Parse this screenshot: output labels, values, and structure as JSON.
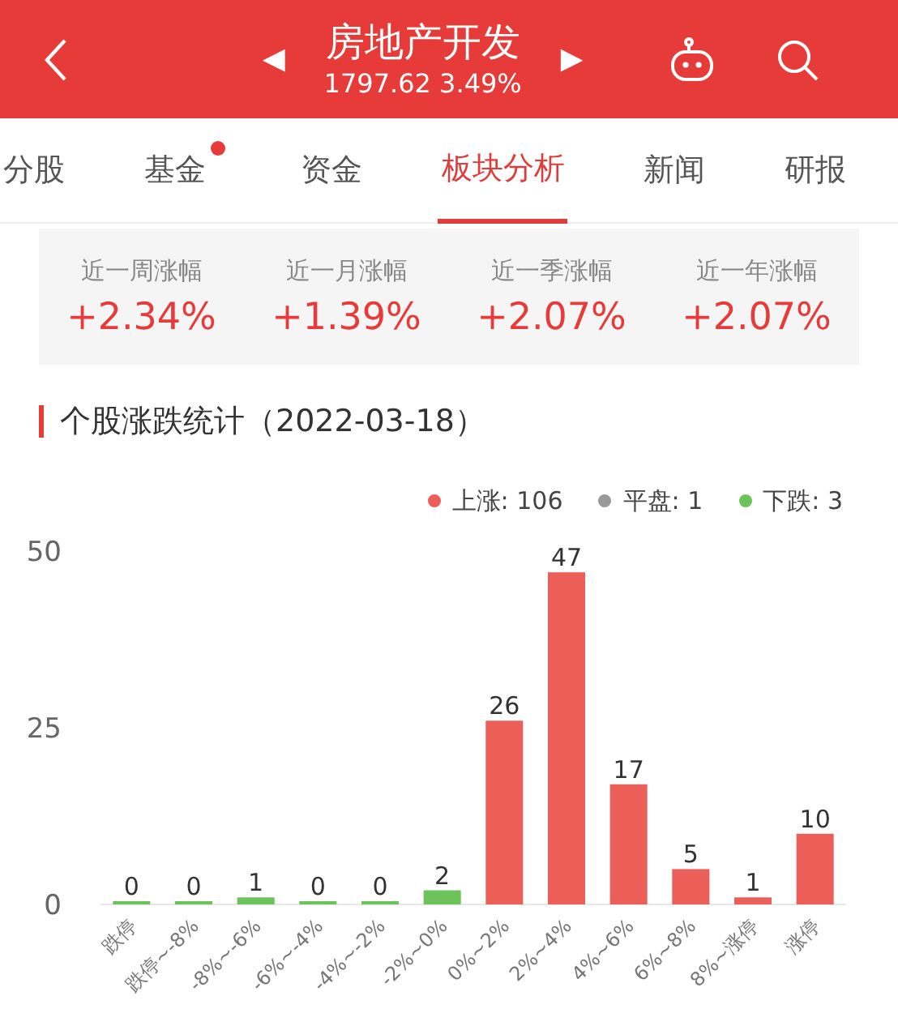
{
  "header": {
    "title": "房地产开发",
    "quote": "1797.62 3.49%",
    "prev": "◀",
    "next": "▶"
  },
  "tabs": [
    {
      "label": "分股",
      "selected": false,
      "dot": false
    },
    {
      "label": "基金",
      "selected": false,
      "dot": true
    },
    {
      "label": "资金",
      "selected": false,
      "dot": false
    },
    {
      "label": "板块分析",
      "selected": true,
      "dot": false
    },
    {
      "label": "新闻",
      "selected": false,
      "dot": false
    },
    {
      "label": "研报",
      "selected": false,
      "dot": false
    }
  ],
  "stats": [
    {
      "label": "近一周涨幅",
      "value": "+2.34%"
    },
    {
      "label": "近一月涨幅",
      "value": "+1.39%"
    },
    {
      "label": "近一季涨幅",
      "value": "+2.07%"
    },
    {
      "label": "近一年涨幅",
      "value": "+2.07%"
    }
  ],
  "section_title": "个股涨跌统计（2022-03-18）",
  "legend": [
    {
      "label": "上涨: 106",
      "color": "#ec5f58"
    },
    {
      "label": "平盘: 1",
      "color": "#999999"
    },
    {
      "label": "下跌: 3",
      "color": "#6cc35a"
    }
  ],
  "chart_data": {
    "type": "bar",
    "stacked": true,
    "data_labels": true,
    "categories": [
      "跌停",
      "跌停~-8%",
      "-8%~-6%",
      "-6%~-4%",
      "-4%~-2%",
      "-2%~0%",
      "0%~2%",
      "2%~4%",
      "4%~6%",
      "6%~8%",
      "8%~涨停",
      "涨停"
    ],
    "series": [
      {
        "color": "#6cc35a",
        "values": [
          0,
          0,
          1,
          0,
          0,
          2,
          null,
          null,
          null,
          null,
          null,
          null
        ]
      },
      {
        "color": "#ec5f58",
        "values": [
          null,
          null,
          null,
          null,
          null,
          null,
          26,
          47,
          17,
          5,
          1,
          10
        ]
      }
    ],
    "ylim": [
      0,
      50
    ],
    "yticks": [
      0,
      25,
      50
    ]
  }
}
